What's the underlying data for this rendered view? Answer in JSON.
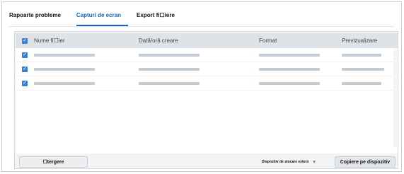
{
  "tabs": [
    {
      "label": "Rapoarte probleme",
      "active": false
    },
    {
      "label": "Capturi de ecran",
      "active": true
    },
    {
      "label": "Export fi☐iere",
      "active": false
    }
  ],
  "table": {
    "columns": [
      "Nume fi☐ier",
      "Dată/oră creare",
      "Format",
      "Previzualizare"
    ],
    "rows_count_label": "",
    "checkbox_glyph": "✓"
  },
  "actions": {
    "delete_label": "☐tergere",
    "device_select_value": "Dispozitiv de stocare extern",
    "copy_label": "Copiere pe dispozitiv"
  },
  "colors": {
    "accent": "#1565c0",
    "checkbox": "#3b82d6"
  }
}
